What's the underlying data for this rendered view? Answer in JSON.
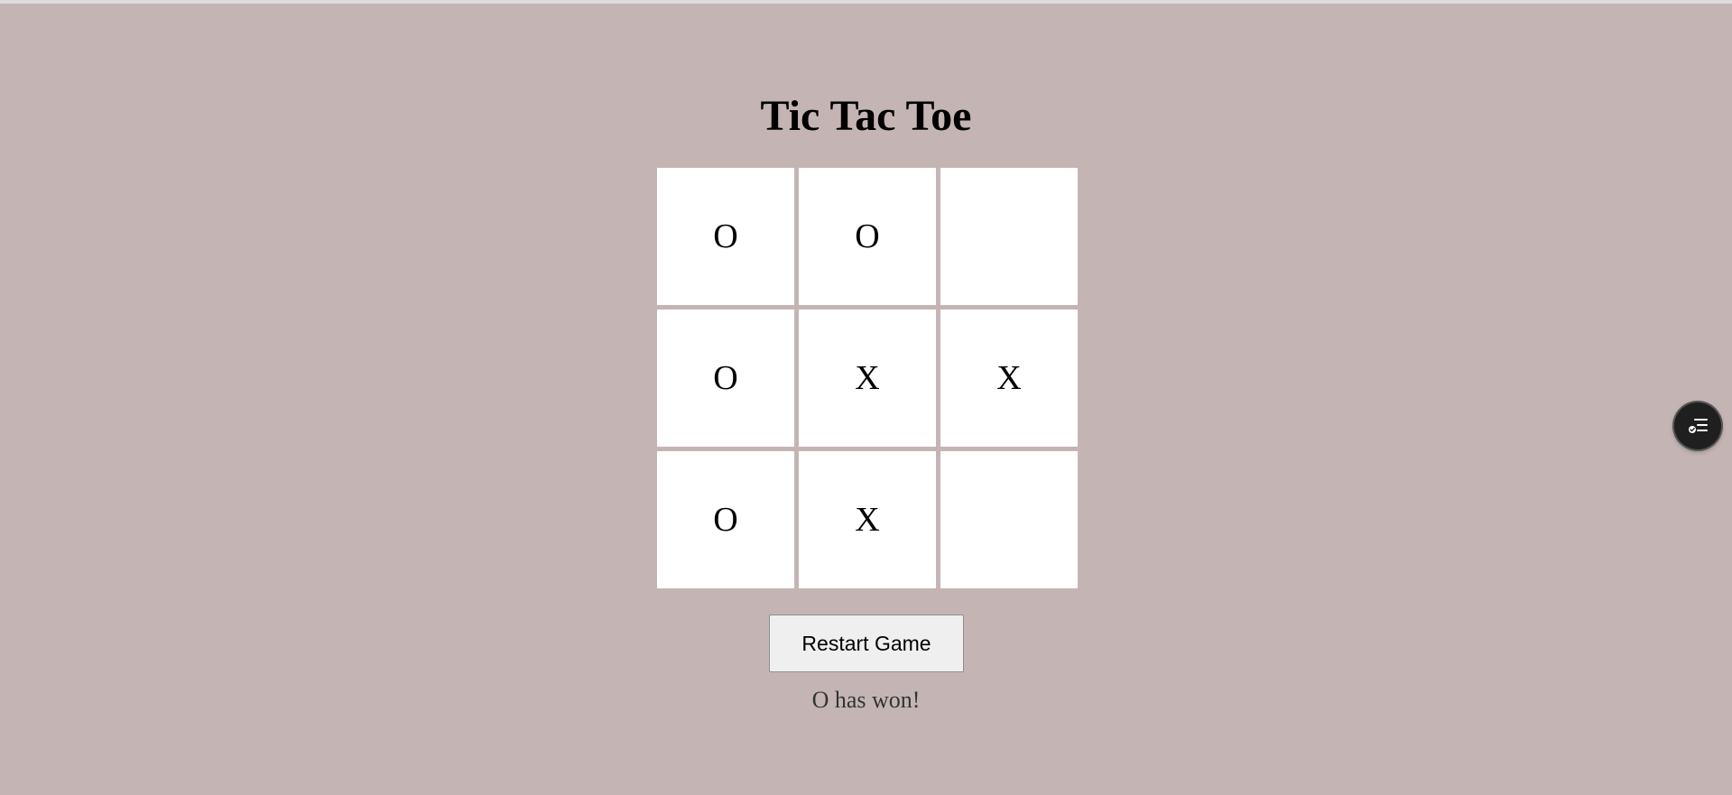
{
  "title": "Tic Tac Toe",
  "board": {
    "cells": [
      "O",
      "O",
      "",
      "O",
      "X",
      "X",
      "O",
      "X",
      ""
    ]
  },
  "restart_label": "Restart Game",
  "status": "O has won!",
  "floating_button": {
    "icon": "checklist-icon"
  },
  "colors": {
    "background": "#c4b5b4",
    "cell": "#ffffff"
  }
}
